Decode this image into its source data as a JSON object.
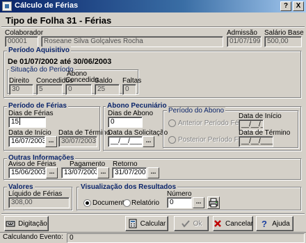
{
  "window": {
    "title": "Cálculo de Férias",
    "help_btn": "?",
    "close_btn": "X"
  },
  "heading": "Tipo de Folha 31 - Férias",
  "colaborador": {
    "label": "Colaborador",
    "code": "00001",
    "name": "Roseane Silva Golçalves Rocha"
  },
  "admissao": {
    "label": "Admissão",
    "value": "01/07/1995"
  },
  "salario": {
    "label": "Salário Base",
    "value": "500,00"
  },
  "periodo_aquisitivo": {
    "title": "Período Aquisitivo",
    "range": "De 01/07/2002  até 30/06/2003",
    "situacao": {
      "title": "Situação do Período",
      "direito_label": "Direito",
      "direito": "30",
      "concedidos_label": "Concedidos",
      "concedidos": "5",
      "abono_label_1": "Abono",
      "abono_label_2": "Concedido",
      "abono": "0",
      "saldo_label": "Saldo",
      "saldo": "25",
      "faltas_label": "Faltas",
      "faltas": "0"
    }
  },
  "periodo_ferias": {
    "title": "Período de Férias",
    "dias_label": "Dias de Férias",
    "dias": "15",
    "inicio_label": "Data de Início",
    "inicio": "16/07/2003",
    "termino_label": "Data de Término",
    "termino": "30/07/2003"
  },
  "abono_pecuniario": {
    "title": "Abono Pecuniário",
    "dias_label": "Dias de Abono",
    "dias": "0",
    "solicitacao_label": "Data da Solicitação",
    "solicitacao": "__/__/____",
    "periodo_title": "Período do Abono",
    "anterior_label": "Anterior Período Férias",
    "posterior_label": "Posterior Período Férias",
    "inicio_label": "Data de Início",
    "inicio": "__/__/____",
    "termino_label": "Data de Término",
    "termino": "__/__/____"
  },
  "outras": {
    "title": "Outras Informações",
    "aviso_label": "Aviso de Férias",
    "aviso": "15/06/2003",
    "pagamento_label": "Pagamento",
    "pagamento": "13/07/2003",
    "retorno_label": "Retorno",
    "retorno": "31/07/2003"
  },
  "valores": {
    "title": "Valores",
    "liquido_label": "Líquido de Férias",
    "liquido": "308,00"
  },
  "visualizacao": {
    "title": "Visualização dos Resultados",
    "documento_label": "Documento",
    "relatorio_label": "Relatório",
    "selected": "Documento",
    "numero_label": "Número",
    "numero": "0"
  },
  "dots": "...",
  "buttons": {
    "digitacao": "Digitação",
    "calcular": "Calcular",
    "ok": "Ok",
    "cancelar": "Cancelar",
    "ajuda": "Ajuda"
  },
  "status": {
    "label": "Calculando Evento:",
    "value": "0"
  }
}
